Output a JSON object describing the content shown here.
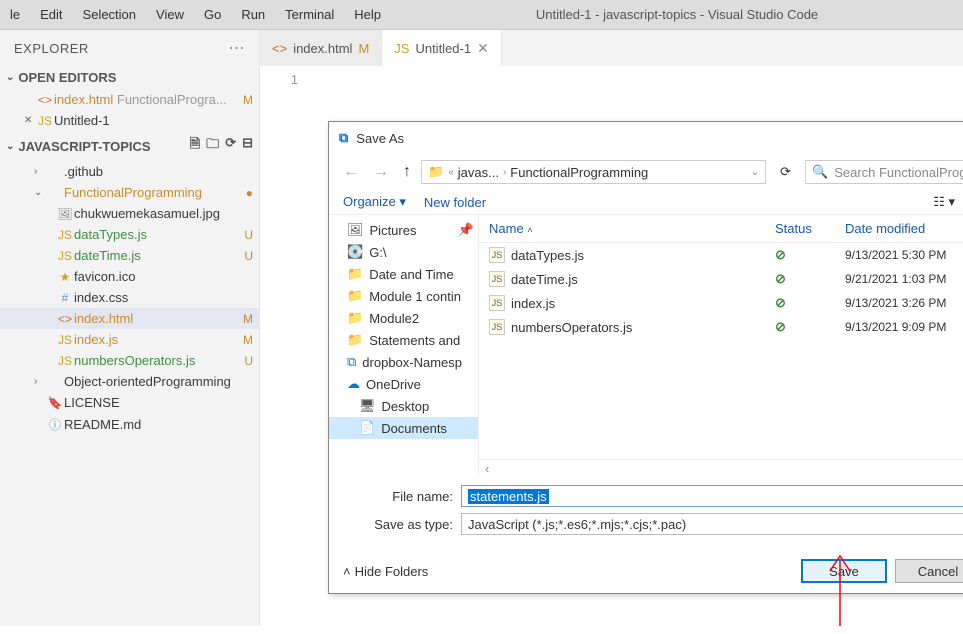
{
  "menubar": {
    "items": [
      "le",
      "Edit",
      "Selection",
      "View",
      "Go",
      "Run",
      "Terminal",
      "Help"
    ],
    "title": "Untitled-1 - javascript-topics - Visual Studio Code"
  },
  "explorer": {
    "title": "EXPLORER",
    "openEditors": {
      "label": "OPEN EDITORS",
      "items": [
        {
          "icon": "<>",
          "name": "index.html",
          "suffix": "FunctionalProgra...",
          "badge": "M",
          "cls": "mod"
        },
        {
          "prefix": "✕",
          "icon": "JS",
          "name": "Untitled-1",
          "suffix": "",
          "badge": ""
        }
      ]
    },
    "project": {
      "label": "JAVASCRIPT-TOPICS",
      "items": [
        {
          "chev": "›",
          "icon": "",
          "name": ".github",
          "badge": "",
          "indent": "nested"
        },
        {
          "chev": "⌄",
          "icon": "",
          "name": "FunctionalProgramming",
          "badge": "●",
          "indent": "nested",
          "cls": "mod"
        },
        {
          "icon": "🖼",
          "name": "chukwuemekasamuel.jpg",
          "badge": "",
          "indent": "deep"
        },
        {
          "icon": "JS",
          "name": "dataTypes.js",
          "badge": "U",
          "indent": "deep",
          "cls": "untracked"
        },
        {
          "icon": "JS",
          "name": "dateTime.js",
          "badge": "U",
          "indent": "deep",
          "cls": "untracked"
        },
        {
          "icon": "★",
          "name": "favicon.ico",
          "badge": "",
          "indent": "deep"
        },
        {
          "icon": "#",
          "name": "index.css",
          "badge": "",
          "indent": "deep"
        },
        {
          "icon": "<>",
          "name": "index.html",
          "badge": "M",
          "indent": "deep",
          "cls": "mod",
          "selected": true
        },
        {
          "icon": "JS",
          "name": "index.js",
          "badge": "M",
          "indent": "deep",
          "cls": "mod"
        },
        {
          "icon": "JS",
          "name": "numbersOperators.js",
          "badge": "U",
          "indent": "deep",
          "cls": "untracked"
        },
        {
          "chev": "›",
          "icon": "",
          "name": "Object-orientedProgramming",
          "badge": "",
          "indent": "nested"
        },
        {
          "icon": "🔖",
          "name": "LICENSE",
          "badge": "",
          "indent": "nested"
        },
        {
          "icon": "ⓘ",
          "name": "README.md",
          "badge": "",
          "indent": "nested"
        }
      ]
    }
  },
  "tabs": [
    {
      "icon": "<>",
      "label": "index.html",
      "badge": "M",
      "active": false
    },
    {
      "icon": "JS",
      "label": "Untitled-1",
      "badge": "",
      "active": true,
      "close": "✕"
    }
  ],
  "gutter": {
    "line1": "1"
  },
  "dialog": {
    "title": "Save As",
    "path": {
      "seg1": "javas...",
      "seg2": "FunctionalProgramming"
    },
    "searchPlaceholder": "Search FunctionalProgramm...",
    "organize": "Organize ▾",
    "newFolder": "New folder",
    "tree": [
      {
        "icon": "🖼",
        "name": "Pictures",
        "pin": "📌"
      },
      {
        "icon": "💽",
        "name": "G:\\"
      },
      {
        "icon": "📁",
        "name": "Date and Time",
        "cls": "folder-ico"
      },
      {
        "icon": "📁",
        "name": "Module 1 contin",
        "cls": "folder-ico"
      },
      {
        "icon": "📁",
        "name": "Module2",
        "cls": "folder-ico"
      },
      {
        "icon": "📁",
        "name": "Statements and",
        "cls": "folder-ico"
      },
      {
        "icon": "⧉",
        "name": "dropbox-Namesp",
        "blue": true
      },
      {
        "icon": "☁",
        "name": "OneDrive",
        "blue": true
      },
      {
        "icon": "🖥",
        "name": "Desktop",
        "indent": true
      },
      {
        "icon": "📄",
        "name": "Documents",
        "indent": true,
        "sel": true
      }
    ],
    "columns": {
      "name": "Name",
      "status": "Status",
      "date": "Date modified"
    },
    "files": [
      {
        "name": "dataTypes.js",
        "status": "⊘",
        "date": "9/13/2021 5:30 PM"
      },
      {
        "name": "dateTime.js",
        "status": "⊘",
        "date": "9/21/2021 1:03 PM"
      },
      {
        "name": "index.js",
        "status": "⊘",
        "date": "9/13/2021 3:26 PM"
      },
      {
        "name": "numbersOperators.js",
        "status": "⊘",
        "date": "9/13/2021 9:09 PM"
      }
    ],
    "fileNameLabel": "File name:",
    "fileName": "statements.js",
    "saveTypeLabel": "Save as type:",
    "saveType": "JavaScript (*.js;*.es6;*.mjs;*.cjs;*.pac)",
    "hideFolders": "Hide Folders",
    "save": "Save",
    "cancel": "Cancel"
  }
}
